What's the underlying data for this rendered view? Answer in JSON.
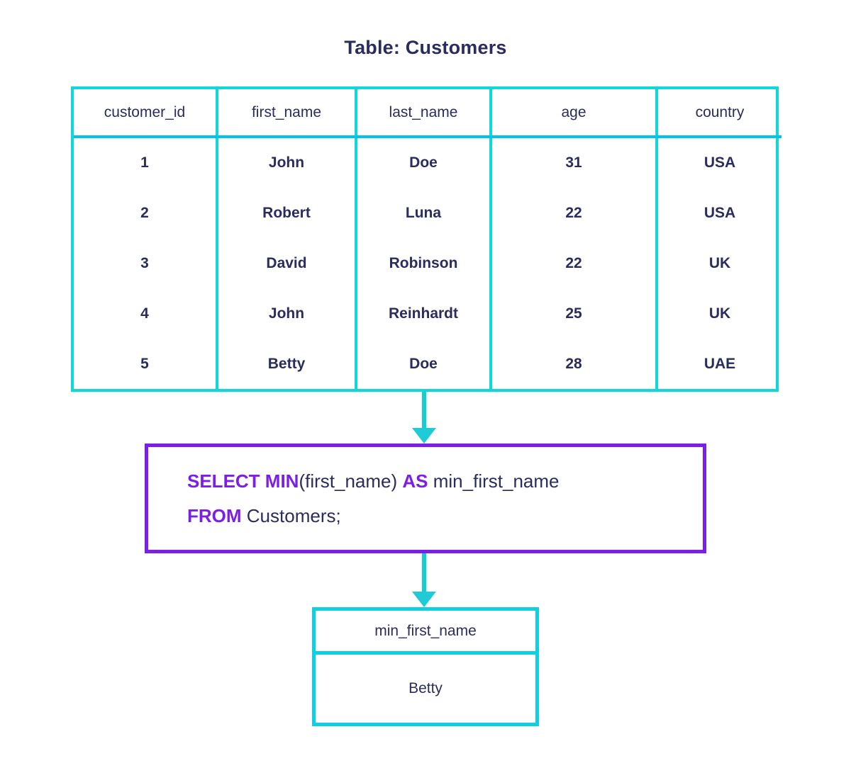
{
  "page_title": "Table: Customers",
  "table": {
    "name": "Customers",
    "columns": [
      "customer_id",
      "first_name",
      "last_name",
      "age",
      "country"
    ],
    "rows": [
      [
        "1",
        "John",
        "Doe",
        "31",
        "USA"
      ],
      [
        "2",
        "Robert",
        "Luna",
        "22",
        "USA"
      ],
      [
        "3",
        "David",
        "Robinson",
        "22",
        "UK"
      ],
      [
        "4",
        "John",
        "Reinhardt",
        "25",
        "UK"
      ],
      [
        "5",
        "Betty",
        "Doe",
        "28",
        "UAE"
      ]
    ]
  },
  "query": {
    "line1": {
      "kw1": "SELECT MIN",
      "arg": "(first_name)",
      "kw2": "AS",
      "alias": "min_first_name"
    },
    "line2": {
      "kw1": "FROM",
      "target": "Customers;"
    },
    "full_text": "SELECT MIN(first_name) AS min_first_name FROM Customers;"
  },
  "result": {
    "column": "min_first_name",
    "value": "Betty"
  },
  "colors": {
    "border_cyan": "#0ed8d8",
    "border_blue": "#00c4e8",
    "arrow": "#1ecbd6",
    "keyword_purple": "#7b1fe8",
    "text_navy": "#2a2c5e"
  }
}
